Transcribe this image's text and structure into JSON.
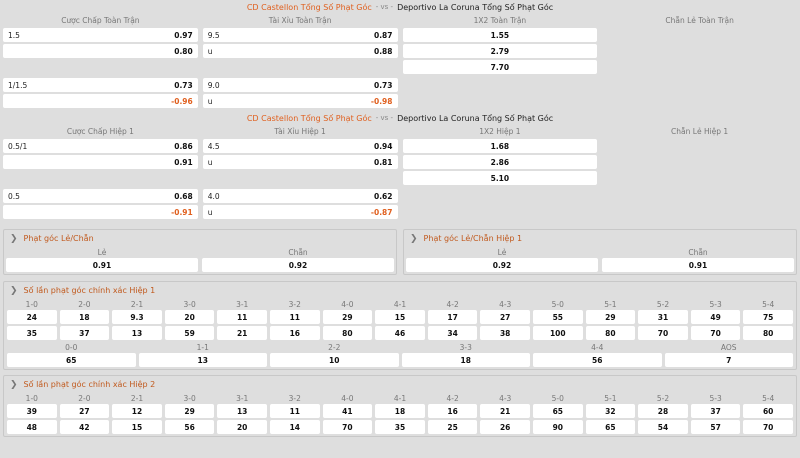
{
  "full": {
    "home": "CD Castellon Tổng Số Phạt Góc",
    "vs": "- vs -",
    "away": "Deportivo La Coruna Tổng Số Phạt Góc",
    "headers": [
      "Cược Chấp Toàn Trận",
      "Tài Xỉu Toàn Trận",
      "1X2 Toàn Trận",
      "Chẵn Lẻ Toàn Trận"
    ],
    "hc1": {
      "line": "1.5",
      "home": "0.97",
      "away": "0.80"
    },
    "ou1": {
      "line": "9.5",
      "over": "0.87",
      "u": "u",
      "under": "0.88"
    },
    "x12": [
      "1.55",
      "2.79",
      "7.70"
    ],
    "hc2": {
      "line": "1/1.5",
      "home": "0.73",
      "away": "-0.96"
    },
    "ou2": {
      "line": "9.0",
      "over": "0.73",
      "u": "u",
      "under": "-0.98"
    }
  },
  "first": {
    "home": "CD Castellon Tổng Số Phạt Góc",
    "vs": "- vs -",
    "away": "Deportivo La Coruna Tổng Số Phạt Góc",
    "headers": [
      "Cược Chấp Hiệp 1",
      "Tài Xỉu Hiệp 1",
      "1X2 Hiệp 1",
      "Chẵn Lẻ Hiệp 1"
    ],
    "hc1": {
      "line": "0.5/1",
      "home": "0.86",
      "away": "0.91"
    },
    "ou1": {
      "line": "4.5",
      "over": "0.94",
      "u": "u",
      "under": "0.81"
    },
    "x12": [
      "1.68",
      "2.86",
      "5.10"
    ],
    "hc2": {
      "line": "0.5",
      "home": "0.68",
      "away": "-0.91"
    },
    "ou2": {
      "line": "4.0",
      "over": "0.62",
      "u": "u",
      "under": "-0.87"
    }
  },
  "oddeven": {
    "title": "Phạt góc Lẻ/Chẵn",
    "labels": [
      "Lẻ",
      "Chẵn"
    ],
    "values": [
      "0.91",
      "0.92"
    ]
  },
  "oddeven1": {
    "title": "Phạt góc Lẻ/Chẵn Hiệp 1",
    "labels": [
      "Lẻ",
      "Chẵn"
    ],
    "values": [
      "0.92",
      "0.91"
    ]
  },
  "cs1": {
    "title": "Số lần phạt góc chính xác Hiệp 1",
    "headers": [
      "1-0",
      "2-0",
      "2-1",
      "3-0",
      "3-1",
      "3-2",
      "4-0",
      "4-1",
      "4-2",
      "4-3",
      "5-0",
      "5-1",
      "5-2",
      "5-3",
      "5-4"
    ],
    "row1": [
      "24",
      "18",
      "9.3",
      "20",
      "11",
      "11",
      "29",
      "15",
      "17",
      "27",
      "55",
      "29",
      "31",
      "49",
      "75"
    ],
    "row2": [
      "35",
      "37",
      "13",
      "59",
      "21",
      "16",
      "80",
      "46",
      "34",
      "38",
      "100",
      "80",
      "70",
      "70",
      "80"
    ],
    "headers2": [
      "0-0",
      "1-1",
      "2-2",
      "3-3",
      "4-4",
      "AOS"
    ],
    "row3": [
      "65",
      "13",
      "10",
      "18",
      "56",
      "7"
    ]
  },
  "cs2": {
    "title": "Số lần phạt góc chính xác Hiệp 2",
    "headers": [
      "1-0",
      "2-0",
      "2-1",
      "3-0",
      "3-1",
      "3-2",
      "4-0",
      "4-1",
      "4-2",
      "4-3",
      "5-0",
      "5-1",
      "5-2",
      "5-3",
      "5-4"
    ],
    "row1": [
      "39",
      "27",
      "12",
      "29",
      "13",
      "11",
      "41",
      "18",
      "16",
      "21",
      "65",
      "32",
      "28",
      "37",
      "60"
    ],
    "row2": [
      "48",
      "42",
      "15",
      "56",
      "20",
      "14",
      "70",
      "35",
      "25",
      "26",
      "90",
      "65",
      "54",
      "57",
      "70"
    ]
  }
}
